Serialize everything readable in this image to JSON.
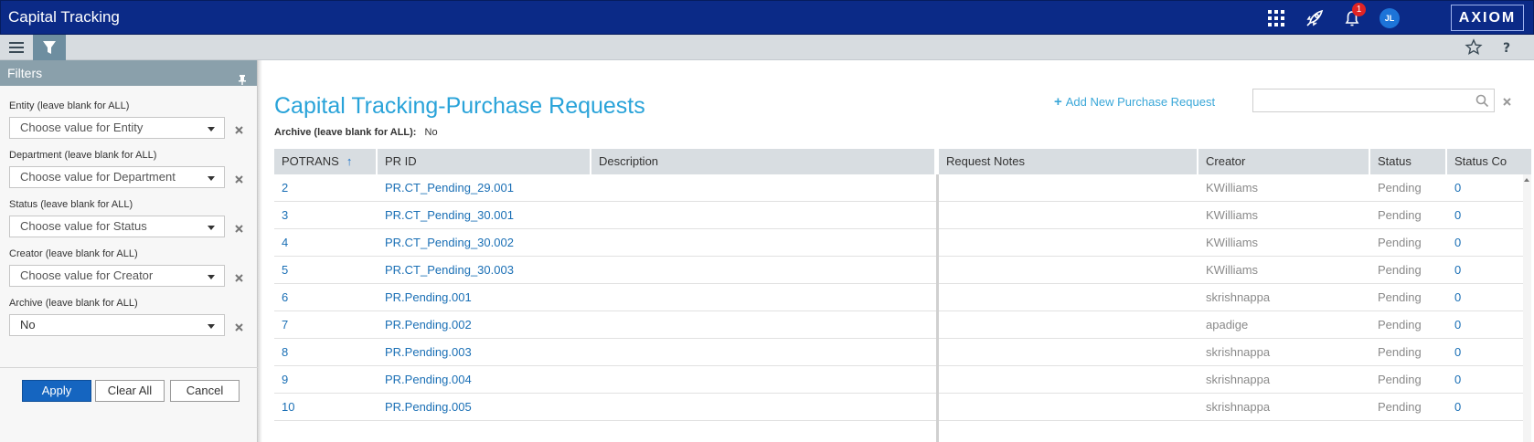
{
  "app": {
    "title": "Capital Tracking",
    "brand": "AXIOM",
    "notification_count": "1",
    "user_initials": "JL"
  },
  "colors": {
    "topbar": "#0b2a87",
    "accent": "#29a3d9",
    "link": "#1a6fb5",
    "primary_button": "#1565c0",
    "filter_header": "#8aa0ab"
  },
  "icons": {
    "topbar": [
      "apps-grid-icon",
      "rocket-icon",
      "bell-icon",
      "user-avatar"
    ],
    "toolbar": [
      "hamburger-menu-icon",
      "filter-icon",
      "star-icon",
      "help-icon"
    ]
  },
  "filters": {
    "title": "Filters",
    "fields": [
      {
        "label": "Entity (leave blank for ALL)",
        "value": "Choose value for Entity"
      },
      {
        "label": "Department (leave blank for ALL)",
        "value": "Choose value for Department"
      },
      {
        "label": "Status (leave blank for ALL)",
        "value": "Choose value for Status"
      },
      {
        "label": "Creator (leave blank for ALL)",
        "value": "Choose value for Creator"
      },
      {
        "label": "Archive (leave blank for ALL)",
        "value": "No"
      }
    ],
    "apply_label": "Apply",
    "clear_label": "Clear All",
    "cancel_label": "Cancel"
  },
  "main": {
    "title": "Capital Tracking-Purchase Requests",
    "archive_label": "Archive (leave blank for ALL):",
    "archive_value": "No",
    "add_label": "Add New Purchase Request",
    "search_value": "",
    "columns": [
      "POTRANS",
      "PR ID",
      "Description",
      "Request Notes",
      "Creator",
      "Status",
      "Status Co"
    ],
    "sort_indicator": "↑",
    "rows": [
      {
        "potrans": "2",
        "prid": "PR.CT_Pending_29.001",
        "description": "",
        "notes": "",
        "creator": "KWilliams",
        "status": "Pending",
        "statusco": "0"
      },
      {
        "potrans": "3",
        "prid": "PR.CT_Pending_30.001",
        "description": "",
        "notes": "",
        "creator": "KWilliams",
        "status": "Pending",
        "statusco": "0"
      },
      {
        "potrans": "4",
        "prid": "PR.CT_Pending_30.002",
        "description": "",
        "notes": "",
        "creator": "KWilliams",
        "status": "Pending",
        "statusco": "0"
      },
      {
        "potrans": "5",
        "prid": "PR.CT_Pending_30.003",
        "description": "",
        "notes": "",
        "creator": "KWilliams",
        "status": "Pending",
        "statusco": "0"
      },
      {
        "potrans": "6",
        "prid": "PR.Pending.001",
        "description": "",
        "notes": "",
        "creator": "skrishnappa",
        "status": "Pending",
        "statusco": "0"
      },
      {
        "potrans": "7",
        "prid": "PR.Pending.002",
        "description": "",
        "notes": "",
        "creator": "apadige",
        "status": "Pending",
        "statusco": "0"
      },
      {
        "potrans": "8",
        "prid": "PR.Pending.003",
        "description": "",
        "notes": "",
        "creator": "skrishnappa",
        "status": "Pending",
        "statusco": "0"
      },
      {
        "potrans": "9",
        "prid": "PR.Pending.004",
        "description": "",
        "notes": "",
        "creator": "skrishnappa",
        "status": "Pending",
        "statusco": "0"
      },
      {
        "potrans": "10",
        "prid": "PR.Pending.005",
        "description": "",
        "notes": "",
        "creator": "skrishnappa",
        "status": "Pending",
        "statusco": "0"
      }
    ]
  }
}
